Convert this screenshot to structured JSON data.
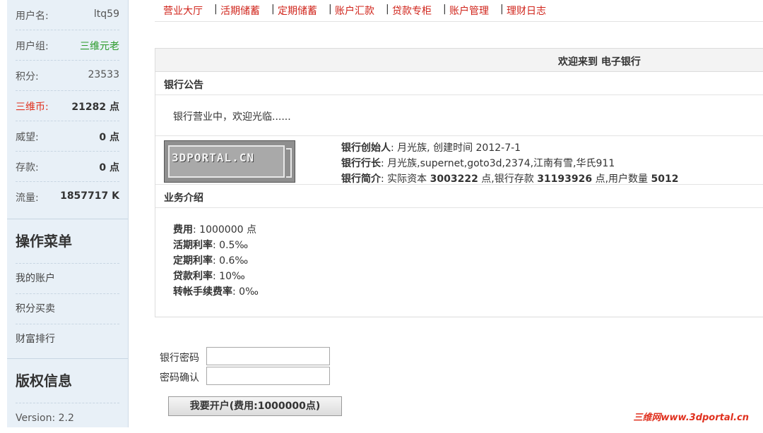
{
  "sidebar": {
    "stats": [
      {
        "key": "用户名:",
        "value": "ltq59"
      },
      {
        "key": "用户组:",
        "value": "三维元老"
      },
      {
        "key": "积分:",
        "value": "23533"
      },
      {
        "key": "三维币:",
        "value": "21282 点"
      },
      {
        "key": "威望:",
        "value": "0 点"
      },
      {
        "key": "存款:",
        "value": "0 点"
      },
      {
        "key": "流量:",
        "value": "1857717 K"
      }
    ],
    "menu_title": "操作菜单",
    "menu_items": [
      "我的账户",
      "积分买卖",
      "财富排行"
    ],
    "copyright_title": "版权信息",
    "version": "Version: 2.2"
  },
  "topnav": [
    "营业大厅",
    "活期储蓄",
    "定期储蓄",
    "账户汇款",
    "贷款专柜",
    "账户管理",
    "理财日志"
  ],
  "panel": {
    "title": "欢迎来到 电子银行",
    "notice_title": "银行公告",
    "notice_text": "银行营业中，欢迎光临......",
    "logo_text": "3DPORTAL.CN",
    "founder_label": "银行创始人",
    "founder_value": ": 月光族, 创建时间 2012-7-1",
    "president_label": "银行行长",
    "president_value": ": 月光族,supernet,goto3d,2374,江南有雪,华氏911",
    "intro_label": "银行简介",
    "intro_prefix": ": 实际资本 ",
    "intro_capital": "3003222",
    "intro_mid": " 点,银行存款 ",
    "intro_deposit": "31193926",
    "intro_mid2": " 点,用户数量 ",
    "intro_users": "5012",
    "biz_title": "业务介绍",
    "biz": [
      {
        "label": "费用",
        "value": ": 1000000 点"
      },
      {
        "label": "活期利率",
        "value": ": 0.5‰"
      },
      {
        "label": "定期利率",
        "value": ": 0.6‰"
      },
      {
        "label": "贷款利率",
        "value": ": 10‰"
      },
      {
        "label": "转帐手续费率",
        "value": ": 0‰"
      }
    ]
  },
  "form": {
    "password_label": "银行密码",
    "confirm_label": "密码确认",
    "password_value": "",
    "confirm_value": "",
    "submit_label": "我要开户(费用:1000000点)"
  },
  "watermark": "三维网www.3dportal.cn"
}
